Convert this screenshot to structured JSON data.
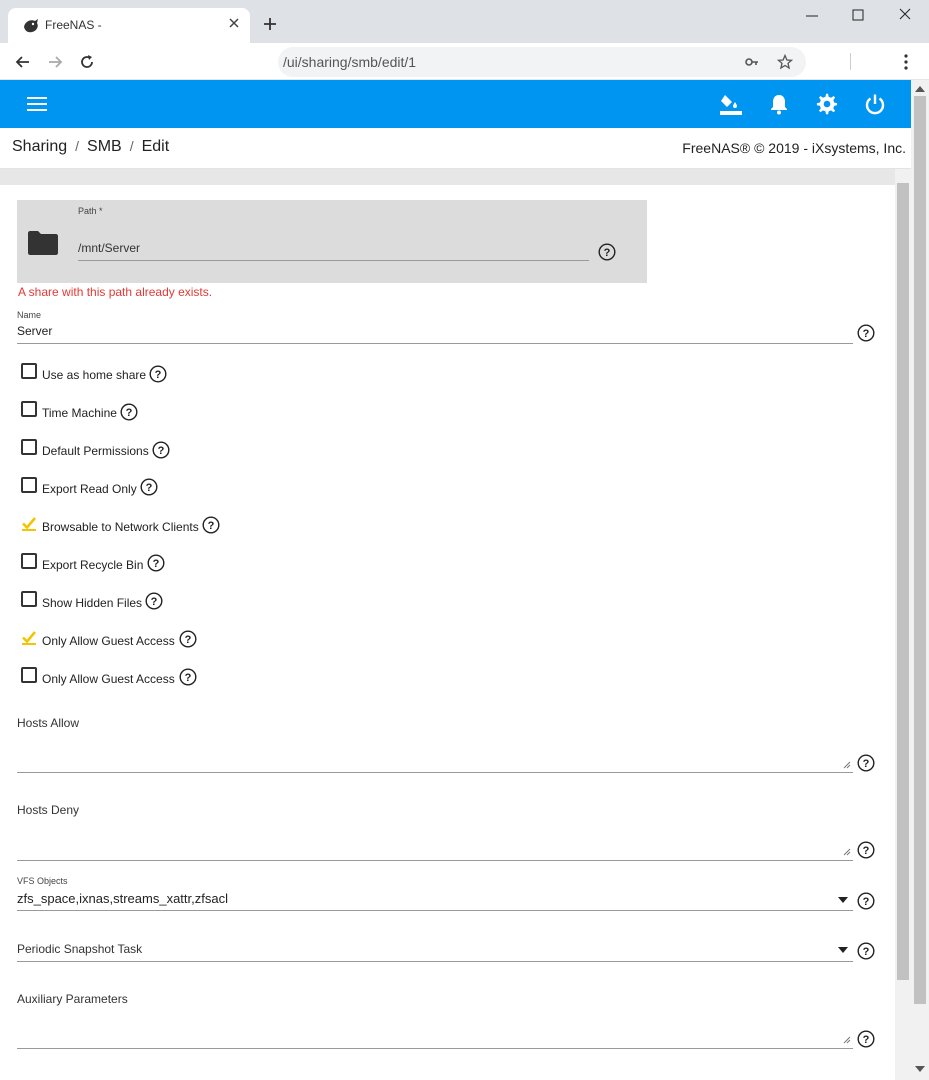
{
  "browser": {
    "tab_title": "FreeNAS -",
    "url": "/ui/sharing/smb/edit/1"
  },
  "breadcrumb": {
    "items": [
      "Sharing",
      "SMB",
      "Edit"
    ],
    "separator": "/"
  },
  "copyright": "FreeNAS® © 2019 - iXsystems, Inc.",
  "form": {
    "path": {
      "label": "Path *",
      "value": "/mnt/Server",
      "error": "A share with this path already exists."
    },
    "name": {
      "label": "Name",
      "value": "Server"
    },
    "checkboxes": [
      {
        "label": "Use as home share",
        "checked": false
      },
      {
        "label": "Time Machine",
        "checked": false
      },
      {
        "label": "Default Permissions",
        "checked": false
      },
      {
        "label": "Export Read Only",
        "checked": false
      },
      {
        "label": "Browsable to Network Clients",
        "checked": true
      },
      {
        "label": "Export Recycle Bin",
        "checked": false
      },
      {
        "label": "Show Hidden Files",
        "checked": false
      },
      {
        "label": "Only Allow Guest Access",
        "checked": true
      },
      {
        "label": "Only Allow Guest Access",
        "checked": false
      }
    ],
    "hosts_allow": {
      "label": "Hosts Allow",
      "value": ""
    },
    "hosts_deny": {
      "label": "Hosts Deny",
      "value": ""
    },
    "vfs_objects": {
      "label": "VFS Objects",
      "value": "zfs_space,ixnas,streams_xattr,zfsacl"
    },
    "periodic_snapshot": {
      "label": "Periodic Snapshot Task",
      "value": ""
    },
    "auxiliary": {
      "label": "Auxiliary Parameters",
      "value": ""
    }
  },
  "colors": {
    "appbar": "#0095f0",
    "checkbox_checked": "#f5c400",
    "error": "#e53935"
  },
  "icons": {
    "appbar": [
      "theme-icon",
      "notifications-icon",
      "settings-icon",
      "power-icon"
    ]
  }
}
